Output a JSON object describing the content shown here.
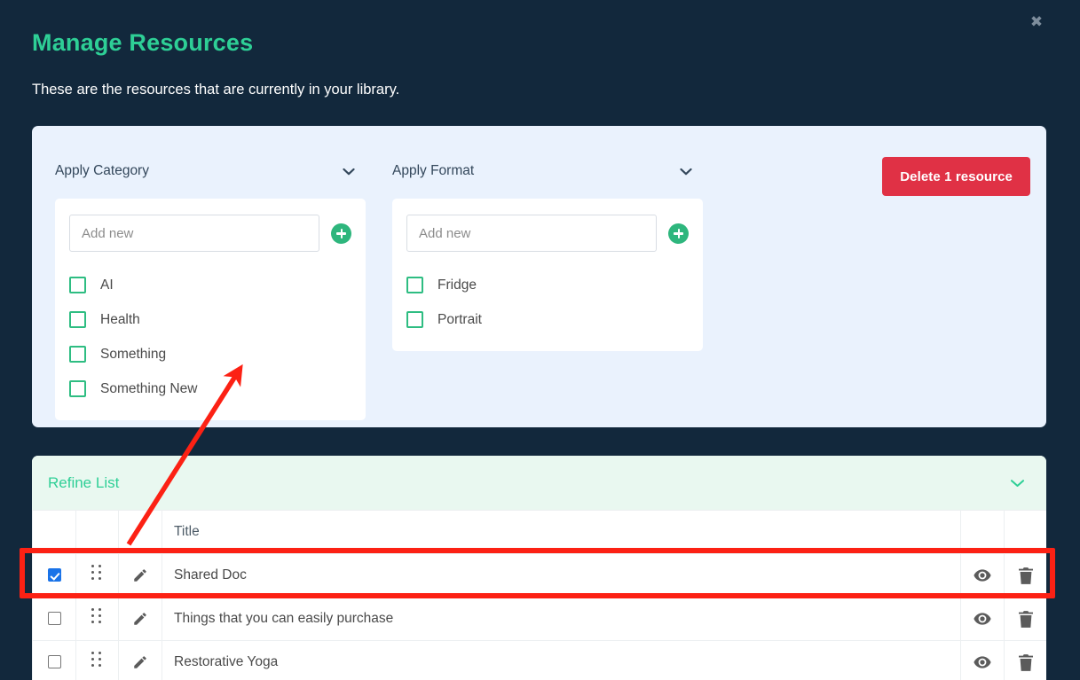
{
  "header": {
    "title": "Manage Resources",
    "subtitle": "These are the resources that are currently in your library.",
    "close_label": "✖",
    "close_icon": "close-icon",
    "title_color": "#2ecf96"
  },
  "filters": {
    "background_color": "#eaf2fd",
    "groups": [
      {
        "label": "Apply Category",
        "chevron_icon": "chevron-down-icon",
        "add_input": {
          "value": "",
          "placeholder": "Add new"
        },
        "add_button_icon": "plus-circle-icon",
        "options": [
          {
            "label": "AI",
            "checked": false
          },
          {
            "label": "Health",
            "checked": false
          },
          {
            "label": "Something",
            "checked": false
          },
          {
            "label": "Something New",
            "checked": false
          }
        ]
      },
      {
        "label": "Apply Format",
        "chevron_icon": "chevron-down-icon",
        "add_input": {
          "value": "",
          "placeholder": "Add new"
        },
        "add_button_icon": "plus-circle-icon",
        "options": [
          {
            "label": "Fridge",
            "checked": false
          },
          {
            "label": "Portrait",
            "checked": false
          }
        ]
      }
    ],
    "delete_button": {
      "label": "Delete 1 resource",
      "color": "#e03145"
    }
  },
  "list": {
    "refine": {
      "label": "Refine List",
      "chevron_icon": "chevron-down-icon",
      "bar_color": "#e9f8f0",
      "text_color": "#2ecf96"
    },
    "columns": {
      "select": "",
      "drag": "",
      "edit": "",
      "title": "Title",
      "view": "",
      "delete": ""
    },
    "rows": [
      {
        "selected": true,
        "title": "Shared Doc",
        "drag_icon": "drag-handle-icon",
        "edit_icon": "pencil-icon",
        "view_icon": "eye-icon",
        "delete_icon": "trash-icon"
      },
      {
        "selected": false,
        "title": "Things that you can easily purchase",
        "drag_icon": "drag-handle-icon",
        "edit_icon": "pencil-icon",
        "view_icon": "eye-icon",
        "delete_icon": "trash-icon"
      },
      {
        "selected": false,
        "title": "Restorative Yoga",
        "drag_icon": "drag-handle-icon",
        "edit_icon": "pencil-icon",
        "view_icon": "eye-icon",
        "delete_icon": "trash-icon"
      }
    ]
  },
  "annotations": {
    "highlight_color": "#fc2114",
    "arrow_color": "#fc2114"
  }
}
